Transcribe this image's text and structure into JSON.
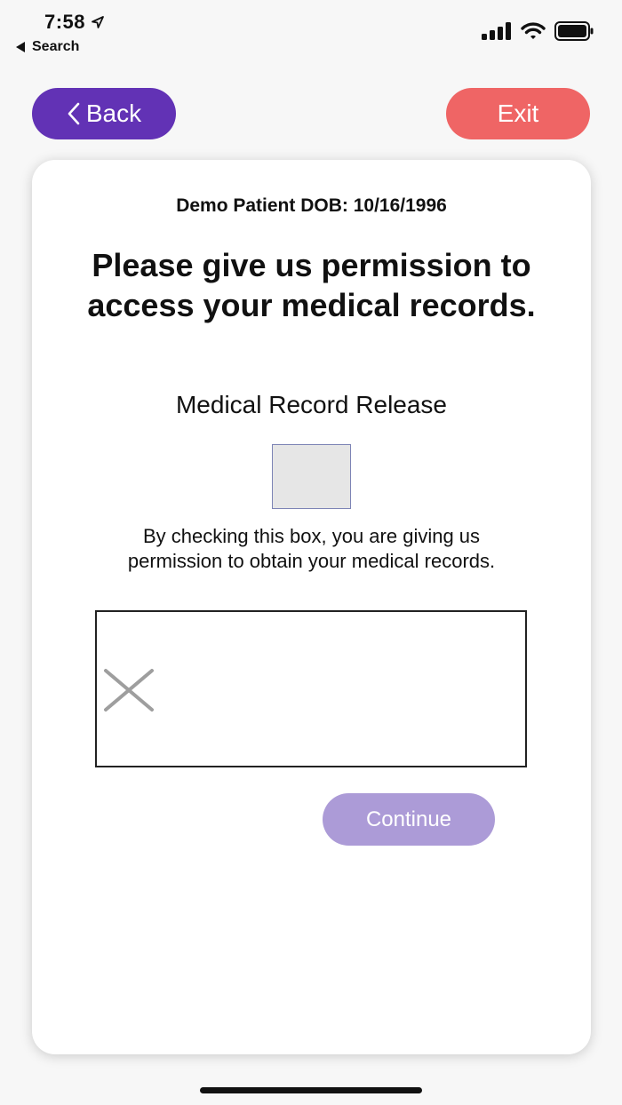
{
  "status_bar": {
    "time": "7:58",
    "back_label": "Search",
    "icons": [
      "location-arrow-icon",
      "cellular-signal-icon",
      "wifi-icon",
      "battery-icon"
    ]
  },
  "nav": {
    "back_label": "Back",
    "exit_label": "Exit"
  },
  "card": {
    "patient_line": "Demo Patient DOB: 10/16/1996",
    "headline": "Please give us permission to access your medical records.",
    "section_title": "Medical Record Release",
    "checkbox_checked": false,
    "consent_text": "By checking this box, you are giving us permission to obtain your medical records.",
    "continue_label": "Continue"
  },
  "colors": {
    "back_button": "#6232b5",
    "exit_button": "#ef6565",
    "continue_button": "#ac9bd7",
    "checkbox_fill": "#e6e6e6",
    "checkbox_border": "#7d84b5"
  }
}
